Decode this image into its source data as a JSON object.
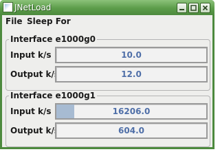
{
  "window": {
    "title": "JNetLoad"
  },
  "menu": {
    "items": [
      "File",
      "Sleep For"
    ]
  },
  "interfaces": [
    {
      "title": "Interface e1000g0",
      "rows": [
        {
          "label": "Input k/s",
          "value": "10.0",
          "fill": 0.0
        },
        {
          "label": "Output k/s",
          "value": "12.0",
          "fill": 0.0
        }
      ]
    },
    {
      "title": "Interface e1000g1",
      "rows": [
        {
          "label": "Input k/s",
          "value": "16206.0",
          "fill": 0.12
        },
        {
          "label": "Output k/s",
          "value": "604.0",
          "fill": 0.0
        }
      ]
    }
  ],
  "colors": {
    "titlebar": "#5c9c4a",
    "bar_fill": "#a7bbd2",
    "value_text": "#4f6fa8"
  },
  "icons": {
    "app": "window-app-icon",
    "minimize": "minimize-icon",
    "maximize": "maximize-icon",
    "close": "close-icon"
  }
}
